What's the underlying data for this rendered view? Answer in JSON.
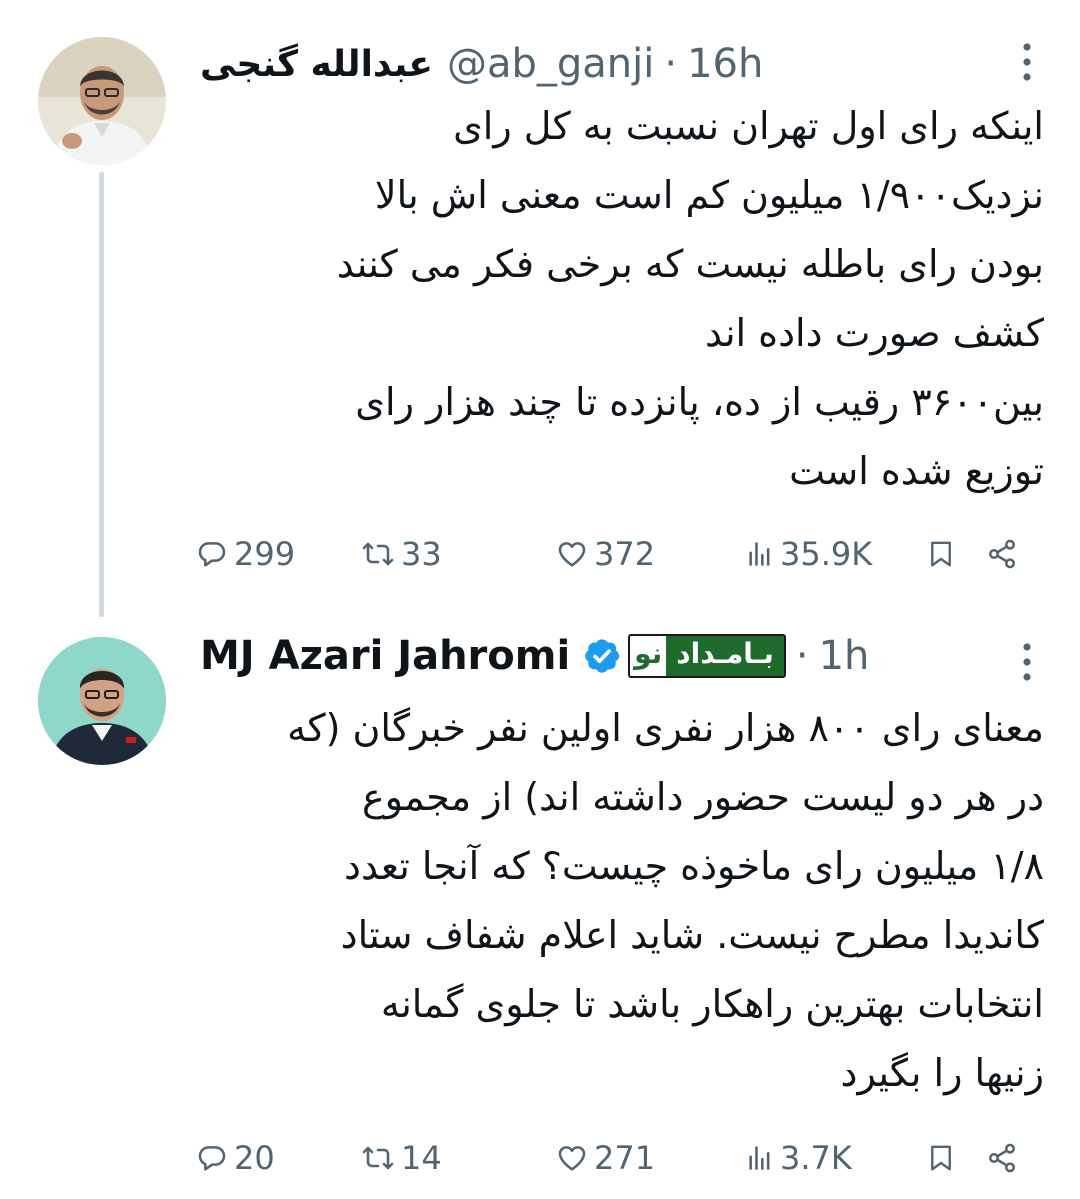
{
  "tweets": [
    {
      "display_name": "عبدالله گنجی",
      "handle": "@ab_ganji",
      "separator": "·",
      "time": "16h",
      "avatar_icon": "user-avatar-photo",
      "text_lines": [
        "اینکه رای اول تهران نسبت به کل رای",
        "نزدیک۱/۹۰۰ میلیون کم است معنی اش بالا",
        "بودن رای باطله نیست که برخی فکر می کنند",
        "کشف صورت داده اند",
        "بین۳۶۰۰ رقیب از ده، پانزده تا چند هزار رای",
        "توزیع شده است"
      ],
      "stats": {
        "replies": "299",
        "retweets": "33",
        "likes": "372",
        "views": "35.9K"
      }
    },
    {
      "display_name": "MJ Azari Jahromi",
      "verified": true,
      "badge_part1": "نو",
      "badge_part2": "بـامـداد",
      "separator": "·",
      "time": "1h",
      "avatar_icon": "user-avatar-photo",
      "text_lines": [
        "معنای رای ۸۰۰ هزار نفری اولین نفر خبرگان (که",
        "در هر دو لیست حضور داشته اند) از مجموع",
        "۱/۸ میلیون رای ماخوذه چیست؟ که آنجا تعدد",
        "کاندیدا مطرح نیست. شاید اعلام شفاف ستاد",
        "انتخابات بهترین راهکار باشد تا جلوی گمانه",
        "زنیها را بگیرد"
      ],
      "stats": {
        "replies": "20",
        "retweets": "14",
        "likes": "271",
        "views": "3.7K"
      }
    }
  ],
  "colors": {
    "text": "#0f1419",
    "secondary": "#536471",
    "verified": "#1d9bf0",
    "thread_line": "#cfd9de",
    "badge_green": "#1e6b2c"
  }
}
